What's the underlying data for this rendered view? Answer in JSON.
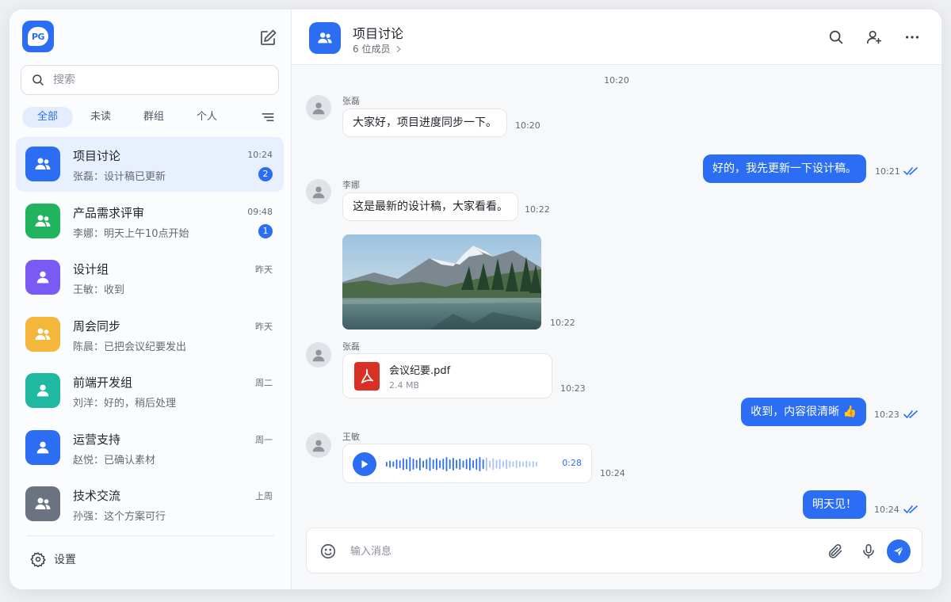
{
  "app": {
    "logo_text": "PG",
    "accent": "#2b6ef3"
  },
  "search": {
    "placeholder": "搜索"
  },
  "filters": [
    {
      "label": "全部",
      "active": true
    },
    {
      "label": "未读",
      "active": false
    },
    {
      "label": "群组",
      "active": false
    },
    {
      "label": "个人",
      "active": false
    }
  ],
  "conversations": [
    {
      "name": "项目讨论",
      "preview": "张磊：设计稿已更新",
      "time": "10:24",
      "badge": "2",
      "color": "#2b6ef3",
      "icon": "group-icon",
      "active": true
    },
    {
      "name": "产品需求评审",
      "preview": "李娜：明天上午10点开始",
      "time": "09:48",
      "badge": "1",
      "color": "#22b35e",
      "icon": "group-icon",
      "active": false
    },
    {
      "name": "设计组",
      "preview": "王敏：收到",
      "time": "昨天",
      "badge": "",
      "color": "#7a5af5",
      "icon": "person-icon",
      "active": false
    },
    {
      "name": "周会同步",
      "preview": "陈晨：已把会议纪要发出",
      "time": "昨天",
      "badge": "",
      "color": "#f5b73b",
      "icon": "group-icon",
      "active": false
    },
    {
      "name": "前端开发组",
      "preview": "刘洋：好的，稍后处理",
      "time": "周二",
      "badge": "",
      "color": "#1fb8a0",
      "icon": "person-icon",
      "active": false
    },
    {
      "name": "运营支持",
      "preview": "赵悦：已确认素材",
      "time": "周一",
      "badge": "",
      "color": "#2b6ef3",
      "icon": "person-icon",
      "active": false
    },
    {
      "name": "技术交流",
      "preview": "孙强：这个方案可行",
      "time": "上周",
      "badge": "",
      "color": "#6b7280",
      "icon": "group-icon",
      "active": false
    }
  ],
  "settings": {
    "label": "设置"
  },
  "header": {
    "title": "项目讨论",
    "members": "6 位成员"
  },
  "chat": {
    "top_time": "10:20",
    "m1": {
      "sender": "张磊",
      "text": "大家好，项目进度同步一下。",
      "time": "10:20"
    },
    "m2": {
      "text": "好的，我先更新一下设计稿。",
      "time": "10:21"
    },
    "m3": {
      "sender": "李娜",
      "text": "这是最新的设计稿，大家看看。",
      "time": "10:22"
    },
    "m4": {
      "time": "10:22"
    },
    "m5": {
      "sender": "张磊",
      "file_name": "会议纪要.pdf",
      "file_size": "2.4 MB",
      "time": "10:23"
    },
    "m6": {
      "text": "收到，内容很清晰 👍",
      "time": "10:23"
    },
    "m7": {
      "sender": "王敏",
      "duration": "0:28",
      "time": "10:24"
    },
    "m8": {
      "text": "明天见！",
      "time": "10:24"
    }
  },
  "composer": {
    "placeholder": "输入消息"
  }
}
